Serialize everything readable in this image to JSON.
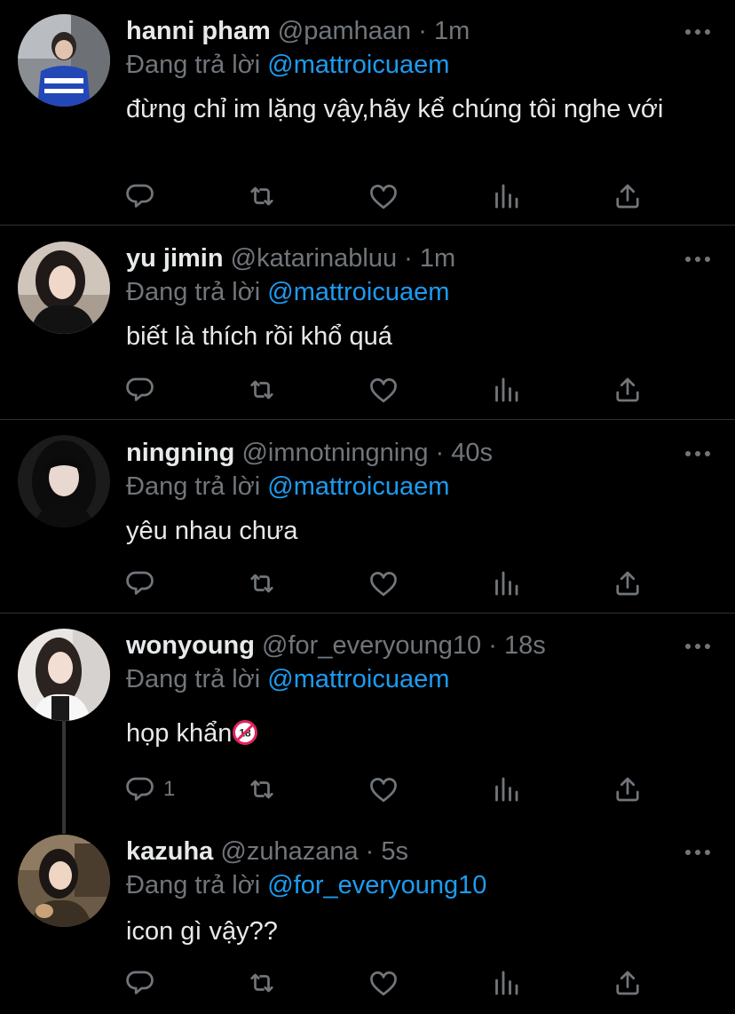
{
  "colors": {
    "background": "#000000",
    "text": "#e7e9ea",
    "muted": "#71767b",
    "link": "#1d9bf0",
    "divider": "#2f3336"
  },
  "reply_prefix": "Đang trả lời",
  "tweets": [
    {
      "name": "hanni pham",
      "handle": "@pamhaan",
      "separator": "·",
      "time": "1m",
      "reply_to": "@mattroicuaem",
      "text": "đừng chỉ im lặng vậy,hãy kể chúng tôi nghe với",
      "reply_count": ""
    },
    {
      "name": "yu jimin",
      "handle": "@katarinabluu",
      "separator": "·",
      "time": "1m",
      "reply_to": "@mattroicuaem",
      "text": "biết là thích rồi khổ quá",
      "reply_count": ""
    },
    {
      "name": "ningning",
      "handle": "@imnotningning",
      "separator": "·",
      "time": "40s",
      "reply_to": "@mattroicuaem",
      "text": "yêu nhau chưa",
      "reply_count": ""
    },
    {
      "name": "wonyoung",
      "handle": "@for_everyoung10",
      "separator": "·",
      "time": "18s",
      "reply_to": "@mattroicuaem",
      "text": "họp khẩn",
      "reply_count": "1"
    },
    {
      "name": "kazuha",
      "handle": "@zuhazana",
      "separator": "·",
      "time": "5s",
      "reply_to": "@for_everyoung10",
      "text": "icon gì vậy??",
      "reply_count": ""
    }
  ],
  "icons": {
    "more": "more-horizontal-icon",
    "reply": "reply-bubble-icon",
    "retweet": "retweet-icon",
    "like": "heart-icon",
    "views": "analytics-bars-icon",
    "share": "share-upload-icon",
    "emoji": "no-one-under-eighteen-emoji"
  }
}
